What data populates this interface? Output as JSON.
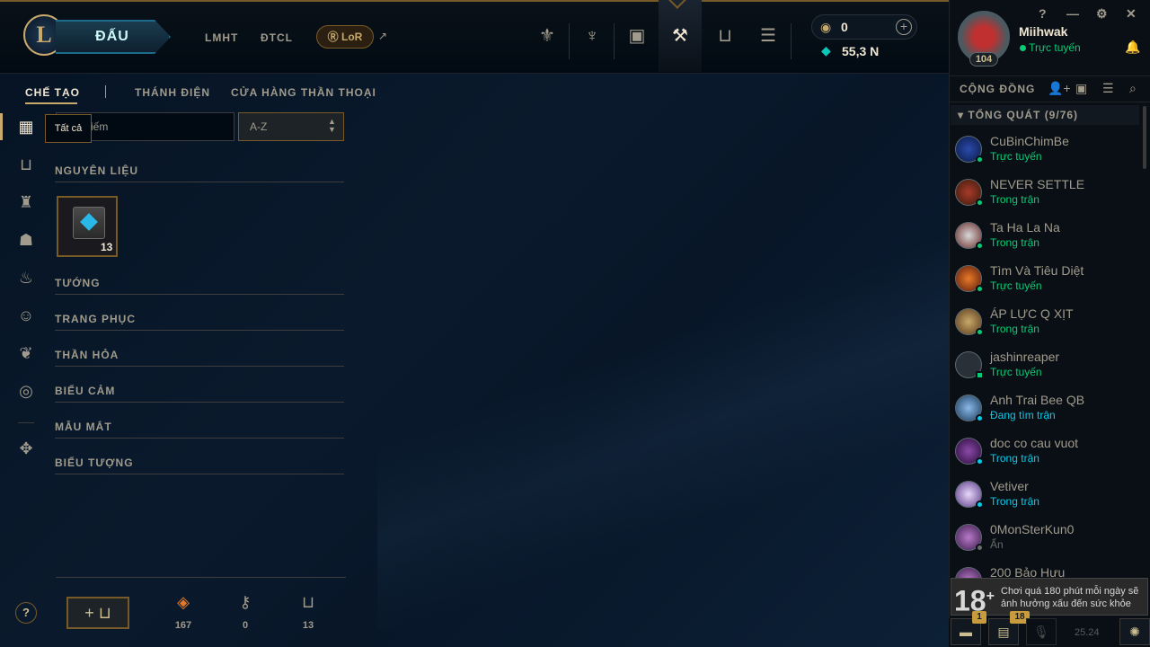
{
  "topnav": {
    "logo_letter": "L",
    "play_label": "ĐẤU",
    "links": [
      "LMHT",
      "ĐTCL"
    ],
    "lor_label": "LoR",
    "external_arrow": "↗",
    "icons": [
      "trophy-icon",
      "clash-icon",
      "inventory-icon",
      "crafting-icon",
      "collection-icon",
      "store-icon"
    ],
    "active_icon": "crafting-icon"
  },
  "currency": {
    "rp_value": "0",
    "be_value": "55,3 N",
    "plus_label": "+"
  },
  "profile": {
    "name": "Miihwak",
    "status": "Trực tuyến",
    "level": "104",
    "window_controls": [
      "?",
      "—",
      "⚙",
      "✕"
    ]
  },
  "social": {
    "title": "CỘNG ĐỒNG",
    "group_title": "TỔNG QUÁT (9/76)",
    "friends": [
      {
        "name": "CuBinChimBe",
        "status": "Trực tuyến",
        "color": "#0acb75"
      },
      {
        "name": "NEVER SETTLE",
        "status": "Trong trận",
        "color": "#0acb75"
      },
      {
        "name": "Ta Ha La Na",
        "status": "Trong trận",
        "color": "#0acb75"
      },
      {
        "name": "Tìm Và Tiêu Diệt",
        "status": "Trực tuyến",
        "color": "#0acb75"
      },
      {
        "name": "ÁP LỰC Q XỊT",
        "status": "Trong trận",
        "color": "#0acb75"
      },
      {
        "name": "jashinreaper",
        "status": "Trực tuyến",
        "color": "#0acb75"
      },
      {
        "name": "Anh Trai Bee QB",
        "status": "Đang tìm trận",
        "color": "#0ac8e8"
      },
      {
        "name": "doc co cau vuot",
        "status": "Trong trận",
        "color": "#0ac8e8"
      },
      {
        "name": "Vetiver",
        "status": "Trong trận",
        "color": "#0ac8e8"
      },
      {
        "name": "0MonSterKun0",
        "status": "Ẩn",
        "color": "#6a6a6a"
      },
      {
        "name": "200 Bảo Hựu",
        "status": "",
        "color": "#6a6a6a"
      }
    ]
  },
  "warning": {
    "age": "18",
    "plus": "+",
    "text": "Chơi quá 180 phút mỗi ngày sẽ ảnh hưởng xấu đến sức khỏe"
  },
  "bottombar": {
    "chat_badge": "1",
    "mission_badge": "18",
    "version": "25.24"
  },
  "subtabs": [
    "CHẾ TẠO",
    "THÁNH ĐIỆN",
    "CỬA HÀNG THẦN THOẠI"
  ],
  "filters": {
    "search_value": "n Kiếm",
    "tooltip": "Tất cả",
    "sort_value": "A-Z"
  },
  "categories": [
    "NGUYÊN LIỆU",
    "TƯỚNG",
    "TRANG PHỤC",
    "THẦN HỎA",
    "BIỂU CẢM",
    "MẪU MẮT",
    "BIỂU TƯỢNG"
  ],
  "item": {
    "count": "13"
  },
  "resources": {
    "essence": "167",
    "keys": "0",
    "chests": "13",
    "help_label": "?"
  }
}
